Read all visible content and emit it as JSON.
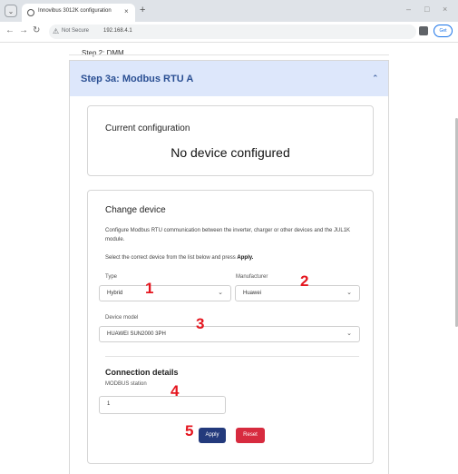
{
  "browser": {
    "tab_title": "Innovi­bus 3012K configuration",
    "tab_close": "×",
    "new_tab": "+",
    "not_secure": "Not Secure",
    "url": "192.168.4.1",
    "profile": "Get"
  },
  "page": {
    "previous_step": "Step 2: DMM",
    "accordion_title": "Step 3a: Modbus RTU A",
    "current": {
      "title": "Current configuration",
      "value": "No device configured"
    },
    "change": {
      "title": "Change device",
      "description": "Configure Modbus RTU communication between the inverter, charger or other devices and the JUL1K module.",
      "hint_prefix": "Select the correct device from the list below and press",
      "hint_bold": "Apply.",
      "type_label": "Type",
      "type_value": "Hybrid",
      "manufacturer_label": "Manufacturer",
      "manufacturer_value": "Huawei",
      "model_label": "Device model",
      "model_value": "HUAWEI SUN2000 3PH",
      "connection_title": "Connection details",
      "station_label": "MODBUS station",
      "station_value": "1",
      "apply_label": "Apply",
      "reset_label": "Reset"
    }
  },
  "markers": [
    "1",
    "2",
    "3",
    "4",
    "5"
  ],
  "colors": {
    "accent": "#233a7c",
    "accordion_bg": "#dde7fb",
    "reset": "#d72b3f",
    "marker": "#e5161f"
  }
}
